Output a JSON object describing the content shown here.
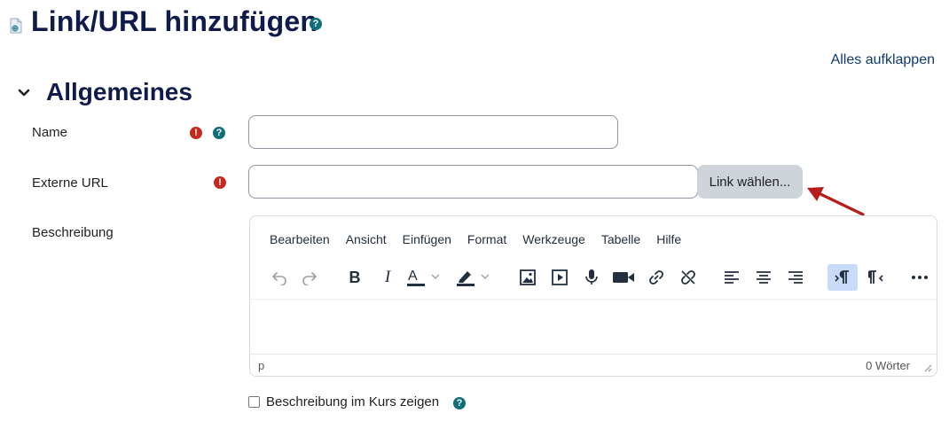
{
  "page": {
    "title": "Link/URL hinzufügen",
    "expand_all": "Alles aufklappen"
  },
  "section": {
    "title": "Allgemeines"
  },
  "fields": {
    "name_label": "Name",
    "name_value": "",
    "url_label": "Externe URL",
    "url_value": "",
    "choose_link_button": "Link wählen...",
    "description_label": "Beschreibung",
    "show_description_label": "Beschreibung im Kurs zeigen",
    "show_description_checked": false
  },
  "editor": {
    "menu": [
      "Bearbeiten",
      "Ansicht",
      "Einfügen",
      "Format",
      "Werkzeuge",
      "Tabelle",
      "Hilfe"
    ],
    "toolbar": [
      "undo-icon",
      "redo-icon",
      "bold-icon",
      "italic-icon",
      "text-color-icon",
      "highlight-color-icon",
      "image-icon",
      "media-icon",
      "record-audio-icon",
      "record-video-icon",
      "link-icon",
      "unlink-icon",
      "align-left-icon",
      "align-center-icon",
      "align-right-icon",
      "ltr-icon",
      "rtl-icon",
      "more-icon"
    ],
    "active_tool": "ltr-icon",
    "status_path": "p",
    "word_count": "0 Wörter",
    "text_color": "#222f3e",
    "active_color": "#c8dbf8"
  },
  "colors": {
    "heading": "#0f1b4a",
    "required": "#c42a1e",
    "help": "#0f6e7a",
    "link": "#0f3a70",
    "annotation_arrow": "#b71c1c"
  }
}
